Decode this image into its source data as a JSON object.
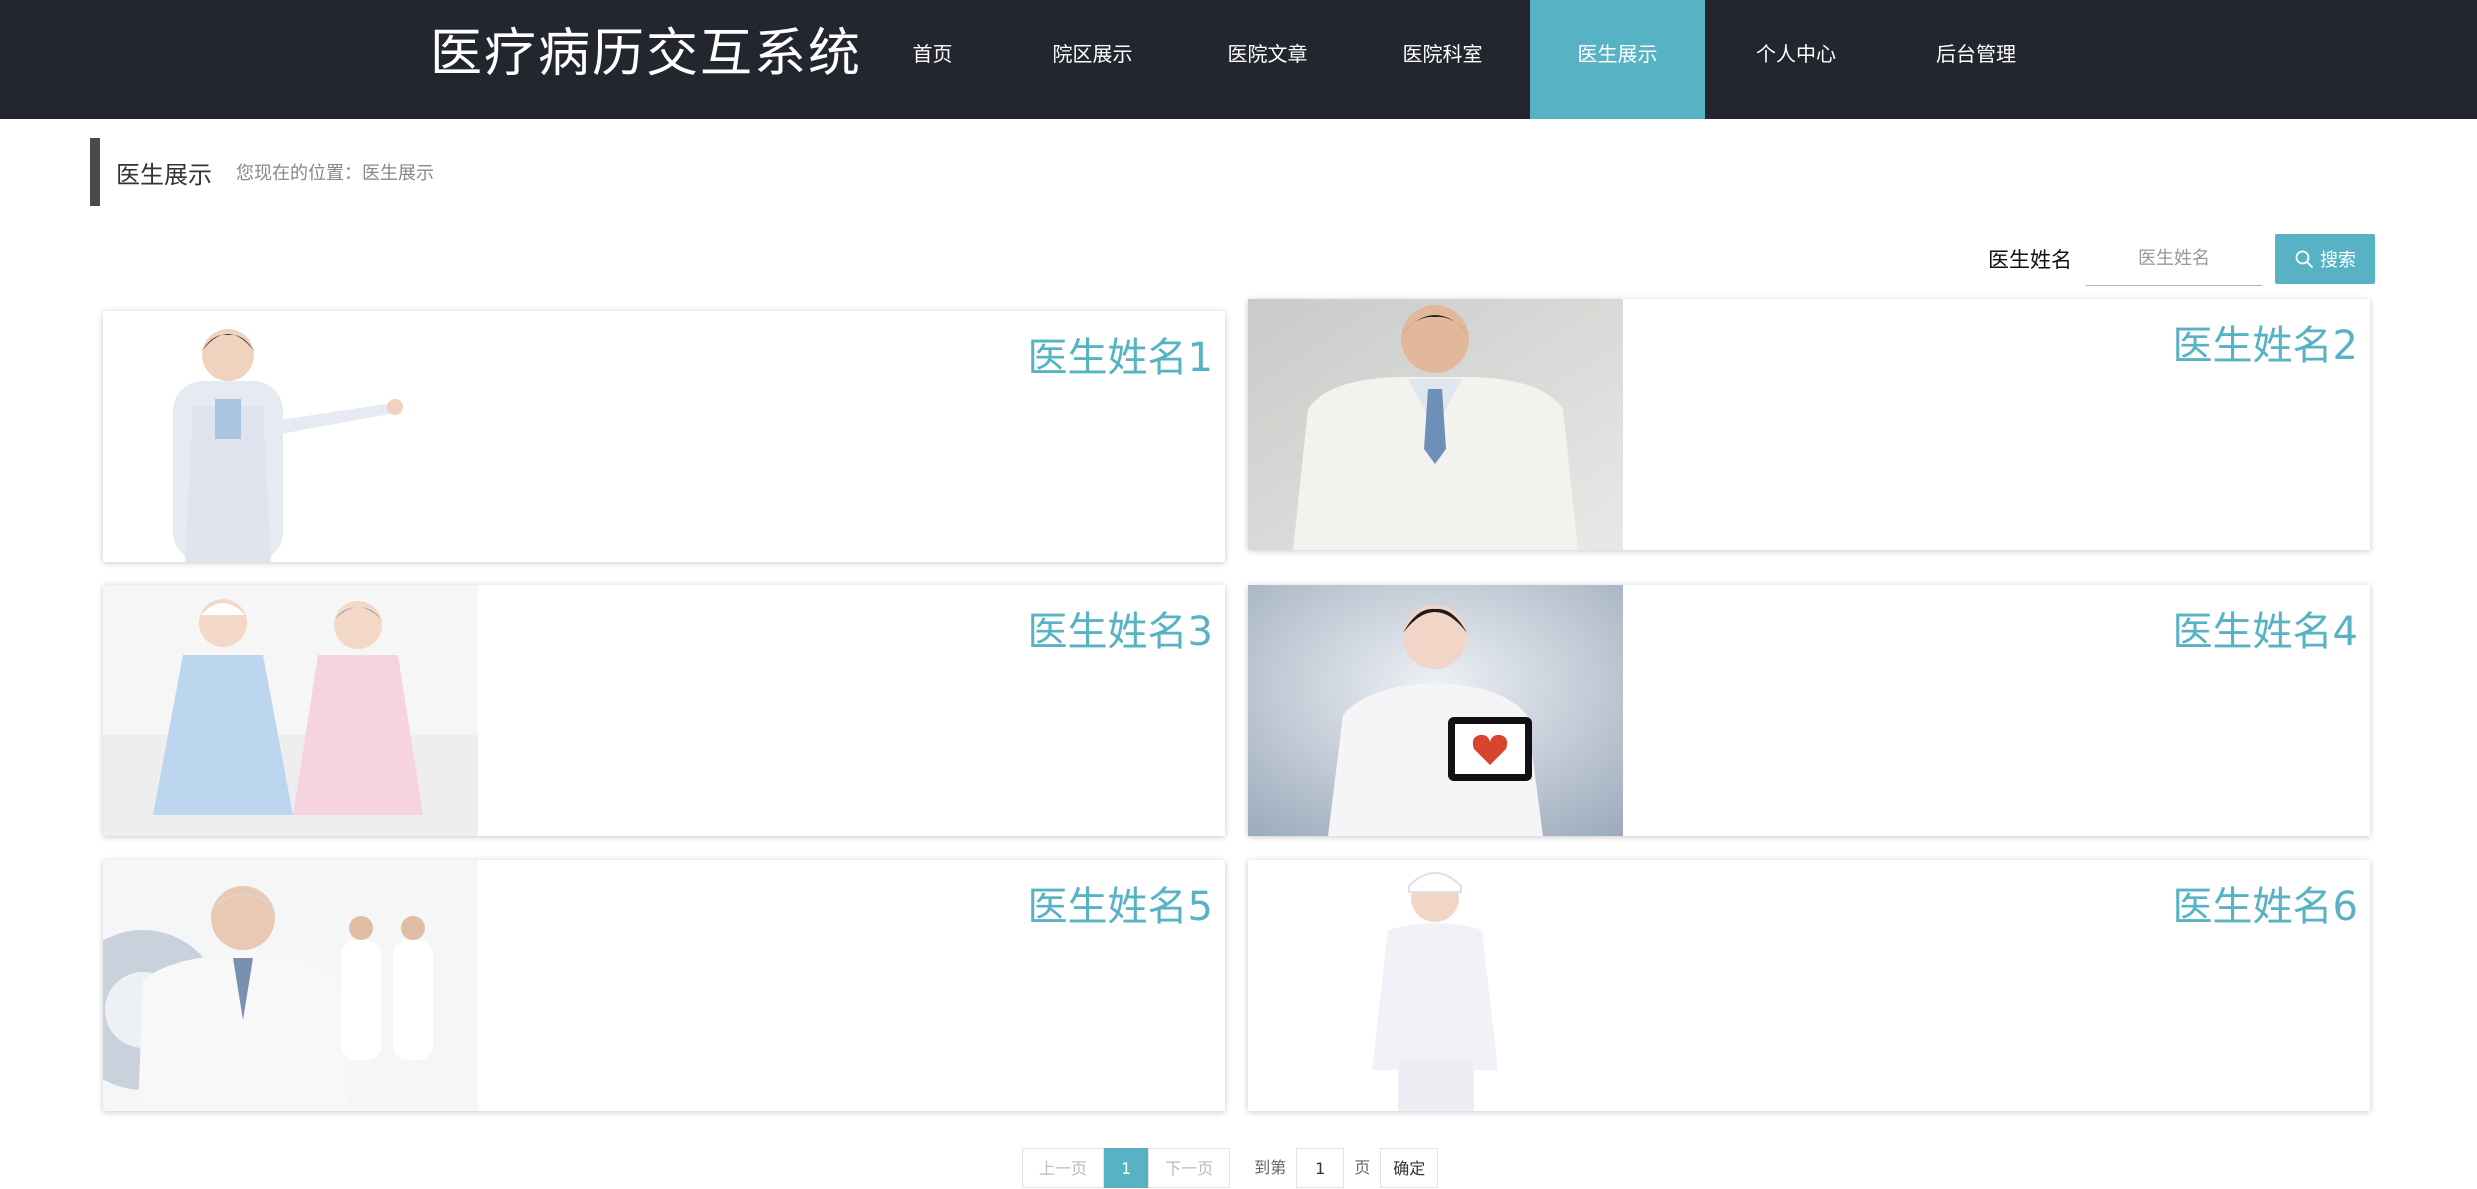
{
  "header": {
    "logo": "医疗病历交互系统",
    "nav": [
      {
        "label": "首页",
        "active": false
      },
      {
        "label": "院区展示",
        "active": false
      },
      {
        "label": "医院文章",
        "active": false
      },
      {
        "label": "医院科室",
        "active": false
      },
      {
        "label": "医生展示",
        "active": true
      },
      {
        "label": "个人中心",
        "active": false
      },
      {
        "label": "后台管理",
        "active": false
      }
    ]
  },
  "breadcrumb": {
    "title": "医生展示",
    "location_label": "您现在的位置：",
    "current": "医生展示"
  },
  "search": {
    "label": "医生姓名",
    "placeholder": "医生姓名",
    "button_label": "搜索"
  },
  "doctors": [
    {
      "name": "医生姓名1"
    },
    {
      "name": "医生姓名2"
    },
    {
      "name": "医生姓名3"
    },
    {
      "name": "医生姓名4"
    },
    {
      "name": "医生姓名5"
    },
    {
      "name": "医生姓名6"
    }
  ],
  "pagination": {
    "prev": "上一页",
    "current_page": "1",
    "next": "下一页",
    "goto_prefix": "到第",
    "goto_value": "1",
    "goto_suffix": "页",
    "confirm": "确定"
  },
  "colors": {
    "header_bg": "#23262e",
    "accent": "#57b3c4",
    "breadcrumb_bar": "#4a4a4a"
  }
}
